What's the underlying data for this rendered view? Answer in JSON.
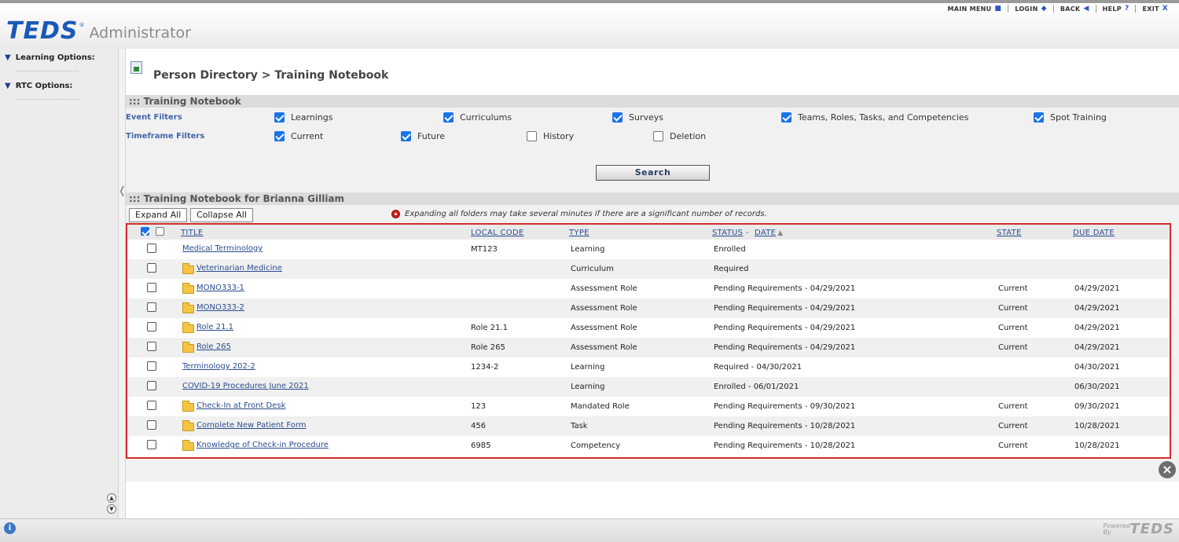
{
  "header": {
    "logo_text": "TEDS",
    "logo_tm": "®",
    "app_name": "Administrator",
    "nav": [
      {
        "label": "MAIN MENU",
        "glyph": "■"
      },
      {
        "label": "LOGIN",
        "glyph": "◆"
      },
      {
        "label": "BACK",
        "glyph": "◀"
      },
      {
        "label": "HELP",
        "glyph": "?"
      },
      {
        "label": "EXIT",
        "glyph": "X"
      }
    ]
  },
  "sidebar": {
    "items": [
      {
        "label": "Learning Options:"
      },
      {
        "label": "RTC Options:"
      }
    ]
  },
  "breadcrumb": "Person Directory > Training Notebook",
  "filters": {
    "section_title": "::: Training Notebook",
    "event_label": "Event Filters",
    "timeframe_label": "Timeframe Filters",
    "event": [
      {
        "label": "Learnings",
        "checked": true
      },
      {
        "label": "Curriculums",
        "checked": true
      },
      {
        "label": "Surveys",
        "checked": true
      },
      {
        "label": "Teams, Roles, Tasks, and Competencies",
        "checked": true
      },
      {
        "label": "Spot Training",
        "checked": true
      }
    ],
    "timeframe": [
      {
        "label": "Current",
        "checked": true
      },
      {
        "label": "Future",
        "checked": true
      },
      {
        "label": "History",
        "checked": false
      },
      {
        "label": "Deletion",
        "checked": false
      }
    ],
    "search_label": "Search"
  },
  "notebook": {
    "section_title": "::: Training Notebook for Brianna Gilliam",
    "expand_all": "Expand All",
    "collapse_all": "Collapse All",
    "warning": "Expanding all folders may take several minutes if there are a significant number of records.",
    "columns": {
      "title": "TITLE",
      "local_code": "LOCAL CODE",
      "type": "TYPE",
      "status": "STATUS",
      "status_sep": "-",
      "date": "DATE",
      "state": "STATE",
      "due_date": "DUE DATE"
    },
    "rows": [
      {
        "title": "Medical Terminology",
        "folder": false,
        "local_code": "MT123",
        "type": "Learning",
        "status": "Enrolled",
        "state": "",
        "due_date": ""
      },
      {
        "title": "Veterinarian Medicine",
        "folder": true,
        "local_code": "",
        "type": "Curriculum",
        "status": "Required",
        "state": "",
        "due_date": ""
      },
      {
        "title": "MONO333-1",
        "folder": true,
        "local_code": "",
        "type": "Assessment Role",
        "status": "Pending Requirements - 04/29/2021",
        "state": "Current",
        "due_date": "04/29/2021"
      },
      {
        "title": "MONO333-2",
        "folder": true,
        "local_code": "",
        "type": "Assessment Role",
        "status": "Pending Requirements - 04/29/2021",
        "state": "Current",
        "due_date": "04/29/2021"
      },
      {
        "title": "Role 21.1",
        "folder": true,
        "local_code": "Role 21.1",
        "type": "Assessment Role",
        "status": "Pending Requirements - 04/29/2021",
        "state": "Current",
        "due_date": "04/29/2021"
      },
      {
        "title": "Role 265",
        "folder": true,
        "local_code": "Role 265",
        "type": "Assessment Role",
        "status": "Pending Requirements - 04/29/2021",
        "state": "Current",
        "due_date": "04/29/2021"
      },
      {
        "title": "Terminology 202-2",
        "folder": false,
        "local_code": "1234-2",
        "type": "Learning",
        "status": "Required  - 04/30/2021",
        "state": "",
        "due_date": "04/30/2021"
      },
      {
        "title": "COVID-19 Procedures June 2021",
        "folder": false,
        "local_code": "",
        "type": "Learning",
        "status": "Enrolled  - 06/01/2021",
        "state": "",
        "due_date": "06/30/2021"
      },
      {
        "title": "Check-In at Front Desk",
        "folder": true,
        "local_code": "123",
        "type": "Mandated Role",
        "status": "Pending Requirements - 09/30/2021",
        "state": "Current",
        "due_date": "09/30/2021"
      },
      {
        "title": "Complete New Patient Form",
        "folder": true,
        "local_code": "456",
        "type": "Task",
        "status": "Pending Requirements - 10/28/2021",
        "state": "Current",
        "due_date": "10/28/2021"
      },
      {
        "title": "Knowledge of Check-in Procedure",
        "folder": true,
        "local_code": "6985",
        "type": "Competency",
        "status": "Pending Requirements - 10/28/2021",
        "state": "Current",
        "due_date": "10/28/2021"
      }
    ]
  },
  "footer": {
    "powered_label": "Powered By",
    "powered_logo": "TEDS"
  },
  "colors": {
    "brand_blue": "#1a59b8",
    "link_blue": "#2a4d8e",
    "grid_border_red": "#d62c2c",
    "folder_yellow": "#f5c542"
  }
}
